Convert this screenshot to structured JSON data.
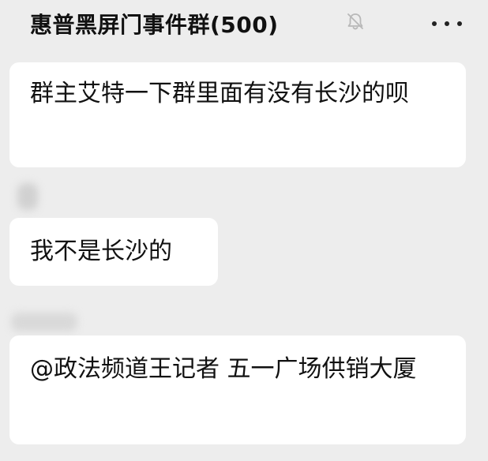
{
  "header": {
    "title": "惠普黑屏门事件群(500)",
    "mute_icon": "bell-slash-icon",
    "more_icon": "more-dots-icon"
  },
  "messages": [
    {
      "text": "群主艾特一下群里面有没有长沙的呗"
    },
    {
      "text": "我不是长沙的"
    },
    {
      "text": "@政法频道王记者  五一广场供销大厦"
    }
  ],
  "colors": {
    "background": "#ededed",
    "bubble": "#ffffff",
    "text": "#111111"
  }
}
